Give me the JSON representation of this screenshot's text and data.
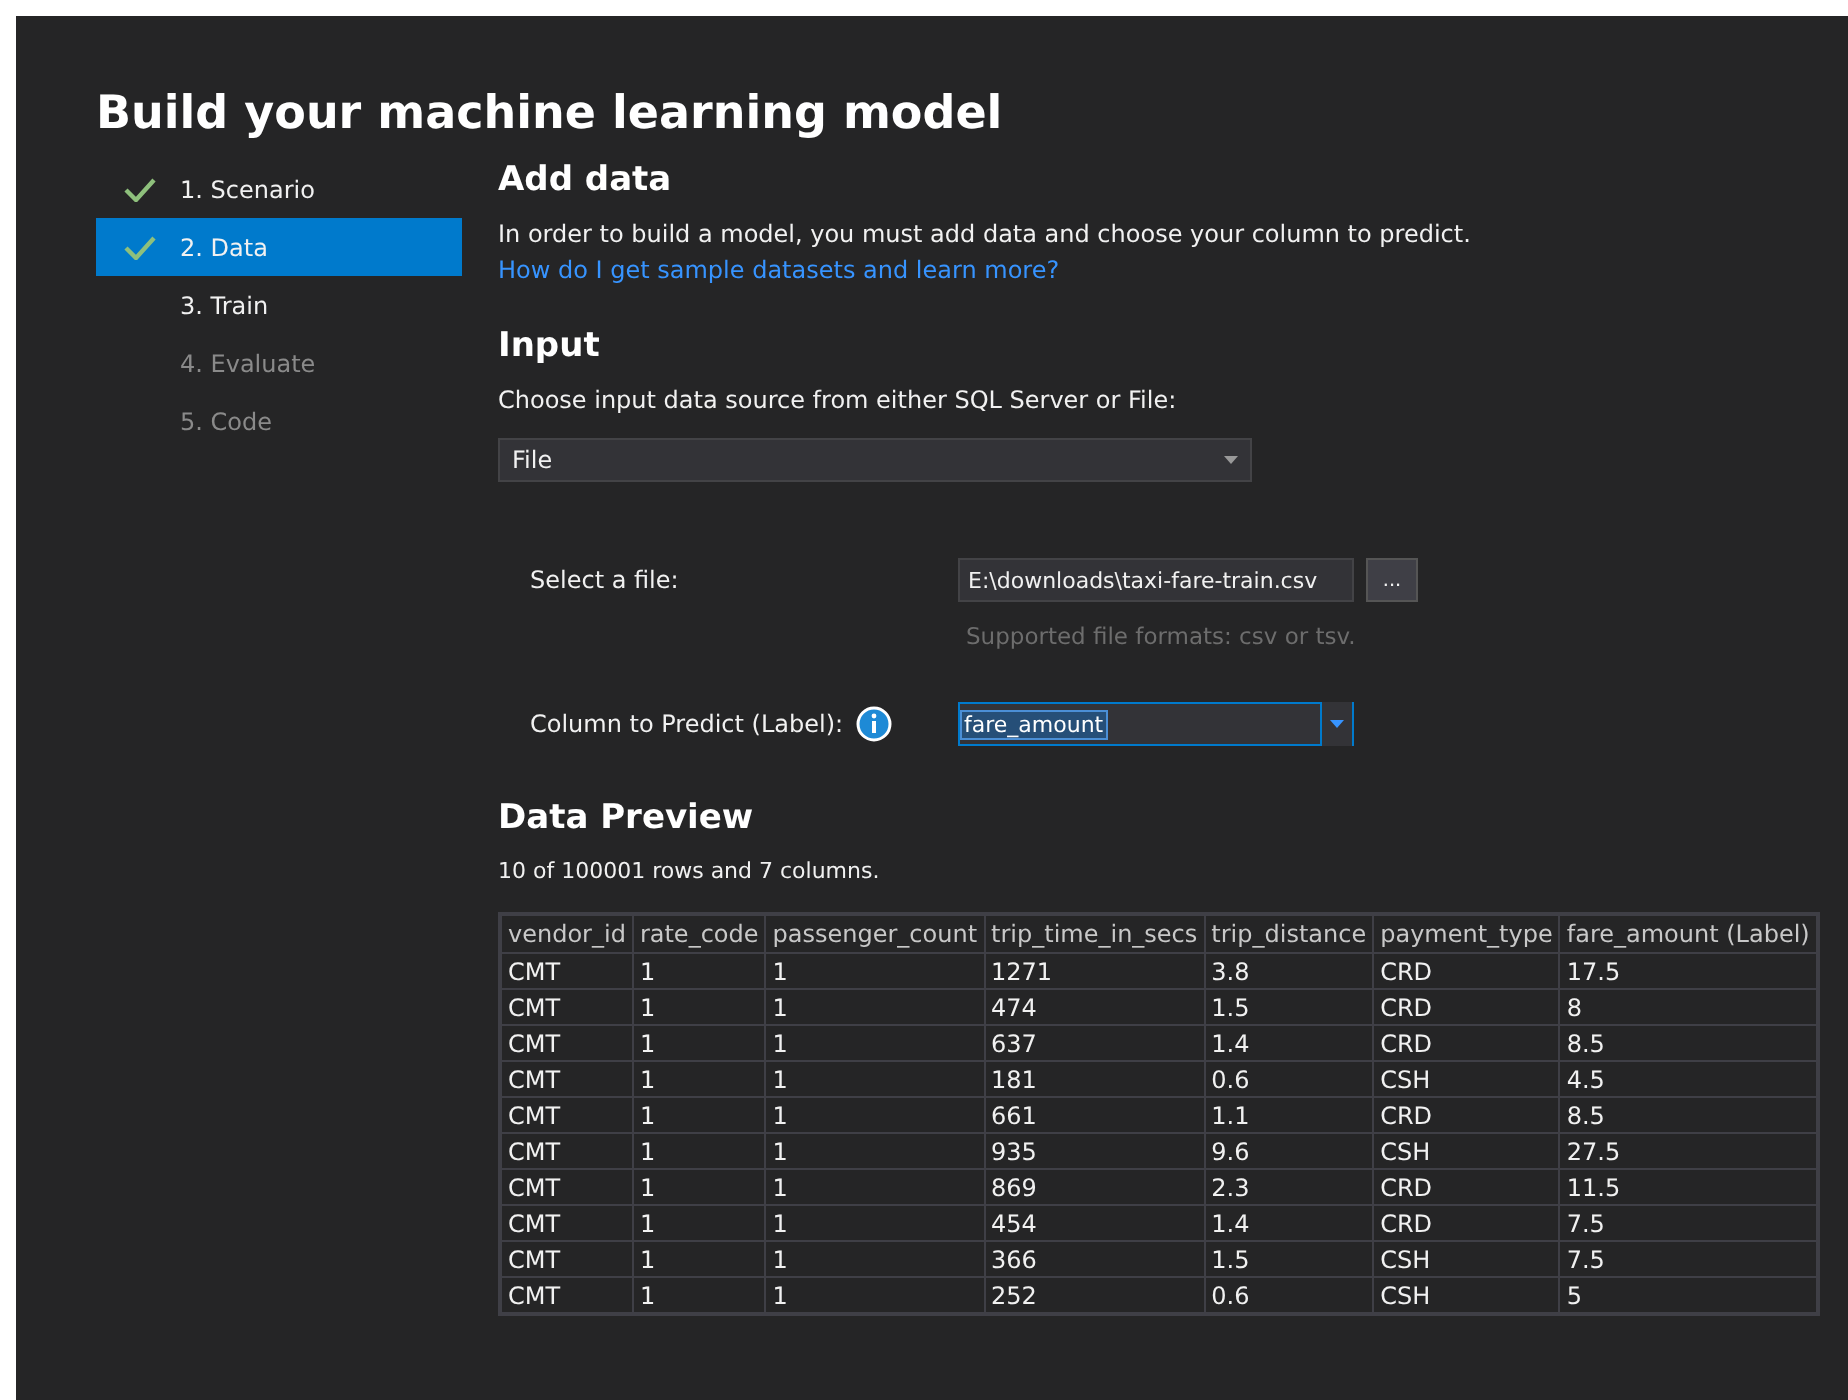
{
  "title": "Build your machine learning model",
  "steps": [
    {
      "label": "1. Scenario",
      "checked": true,
      "selected": false,
      "disabled": false
    },
    {
      "label": "2. Data",
      "checked": true,
      "selected": true,
      "disabled": false
    },
    {
      "label": "3. Train",
      "checked": false,
      "selected": false,
      "disabled": false
    },
    {
      "label": "4. Evaluate",
      "checked": false,
      "selected": false,
      "disabled": true
    },
    {
      "label": "5. Code",
      "checked": false,
      "selected": false,
      "disabled": true
    }
  ],
  "add_data": {
    "heading": "Add data",
    "description": "In order to build a model, you must add data and choose your column to predict.",
    "link": "How do I get sample datasets and learn more?"
  },
  "input": {
    "heading": "Input",
    "description": "Choose input data source from either SQL Server or File:",
    "source": "File",
    "file_label": "Select a file:",
    "file_value": "E:\\downloads\\taxi-fare-train.csv",
    "browse": "...",
    "file_hint": "Supported file formats: csv or tsv.",
    "label_label": "Column to Predict (Label):",
    "label_value": "fare_amount"
  },
  "preview": {
    "heading": "Data Preview",
    "summary": "10 of 100001 rows and 7 columns.",
    "columns": [
      "vendor_id",
      "rate_code",
      "passenger_count",
      "trip_time_in_secs",
      "trip_distance",
      "payment_type",
      "fare_amount (Label)"
    ],
    "rows": [
      [
        "CMT",
        "1",
        "1",
        "1271",
        "3.8",
        "CRD",
        "17.5"
      ],
      [
        "CMT",
        "1",
        "1",
        "474",
        "1.5",
        "CRD",
        "8"
      ],
      [
        "CMT",
        "1",
        "1",
        "637",
        "1.4",
        "CRD",
        "8.5"
      ],
      [
        "CMT",
        "1",
        "1",
        "181",
        "0.6",
        "CSH",
        "4.5"
      ],
      [
        "CMT",
        "1",
        "1",
        "661",
        "1.1",
        "CRD",
        "8.5"
      ],
      [
        "CMT",
        "1",
        "1",
        "935",
        "9.6",
        "CSH",
        "27.5"
      ],
      [
        "CMT",
        "1",
        "1",
        "869",
        "2.3",
        "CRD",
        "11.5"
      ],
      [
        "CMT",
        "1",
        "1",
        "454",
        "1.4",
        "CRD",
        "7.5"
      ],
      [
        "CMT",
        "1",
        "1",
        "366",
        "1.5",
        "CSH",
        "7.5"
      ],
      [
        "CMT",
        "1",
        "1",
        "252",
        "0.6",
        "CSH",
        "5"
      ]
    ]
  }
}
